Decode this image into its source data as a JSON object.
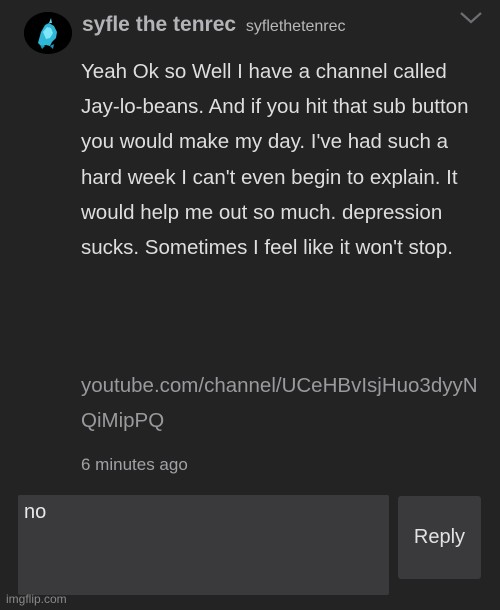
{
  "comment": {
    "author": "syfle the tenrec",
    "handle": "syflethetenrec",
    "avatar_icon": "tenrec-avatar-icon",
    "menu_icon": "chevron-down-icon",
    "body": "Yeah Ok so Well I have a channel called Jay-lo-beans. And if you hit that sub button you would make my day. I've had such a hard week I can't even begin to explain. It would help me out so much. depression sucks. Sometimes I feel like it won't stop.",
    "link": "youtube.com/channel/UCeHBvIsjHuo3dyyNQiMipPQ",
    "timestamp": "6 minutes ago"
  },
  "reply": {
    "input_value": "no",
    "button_label": "Reply"
  },
  "watermark": "imgflip.com",
  "colors": {
    "background": "#232324",
    "input_background": "#3a3a3c",
    "avatar_accent": "#3ec8e8"
  }
}
